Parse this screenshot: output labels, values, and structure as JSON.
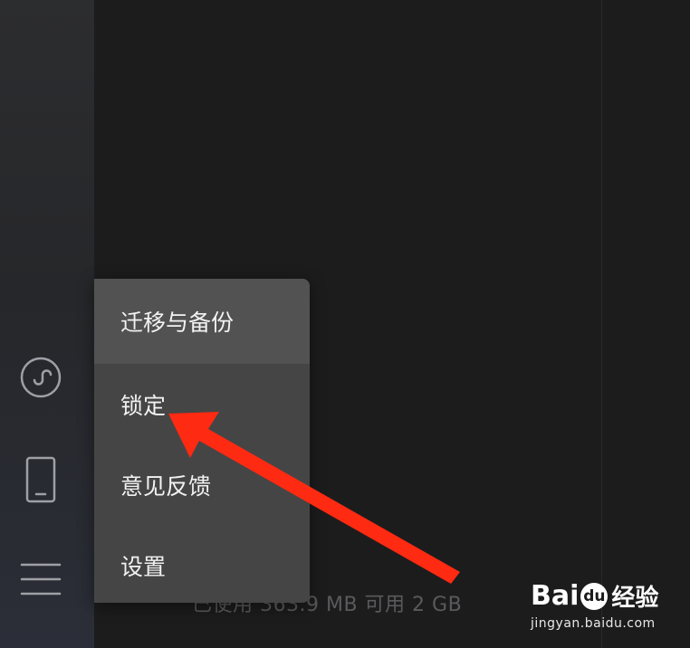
{
  "sidebar": {
    "icons": [
      "miniprogram-icon",
      "phone-icon",
      "menu-icon"
    ]
  },
  "footer": {
    "storage_text": "已使用 363.9 MB 可用 2 GB"
  },
  "popup_menu": {
    "items": [
      {
        "label": "迁移与备份",
        "highlighted": true
      },
      {
        "label": "锁定",
        "highlighted": false
      },
      {
        "label": "意见反馈",
        "highlighted": false
      },
      {
        "label": "设置",
        "highlighted": false
      }
    ]
  },
  "annotation": {
    "arrow_color": "#ff2a12"
  },
  "watermark": {
    "logo_part1": "Bai",
    "logo_du": "du",
    "logo_part2": "经验",
    "url": "jingyan.baidu.com"
  },
  "colors": {
    "background": "#1c1c1d",
    "sidebar": "#2b2d31",
    "menu_bg": "#454545",
    "menu_hover": "#525252",
    "menu_text": "#f2f2f2"
  }
}
